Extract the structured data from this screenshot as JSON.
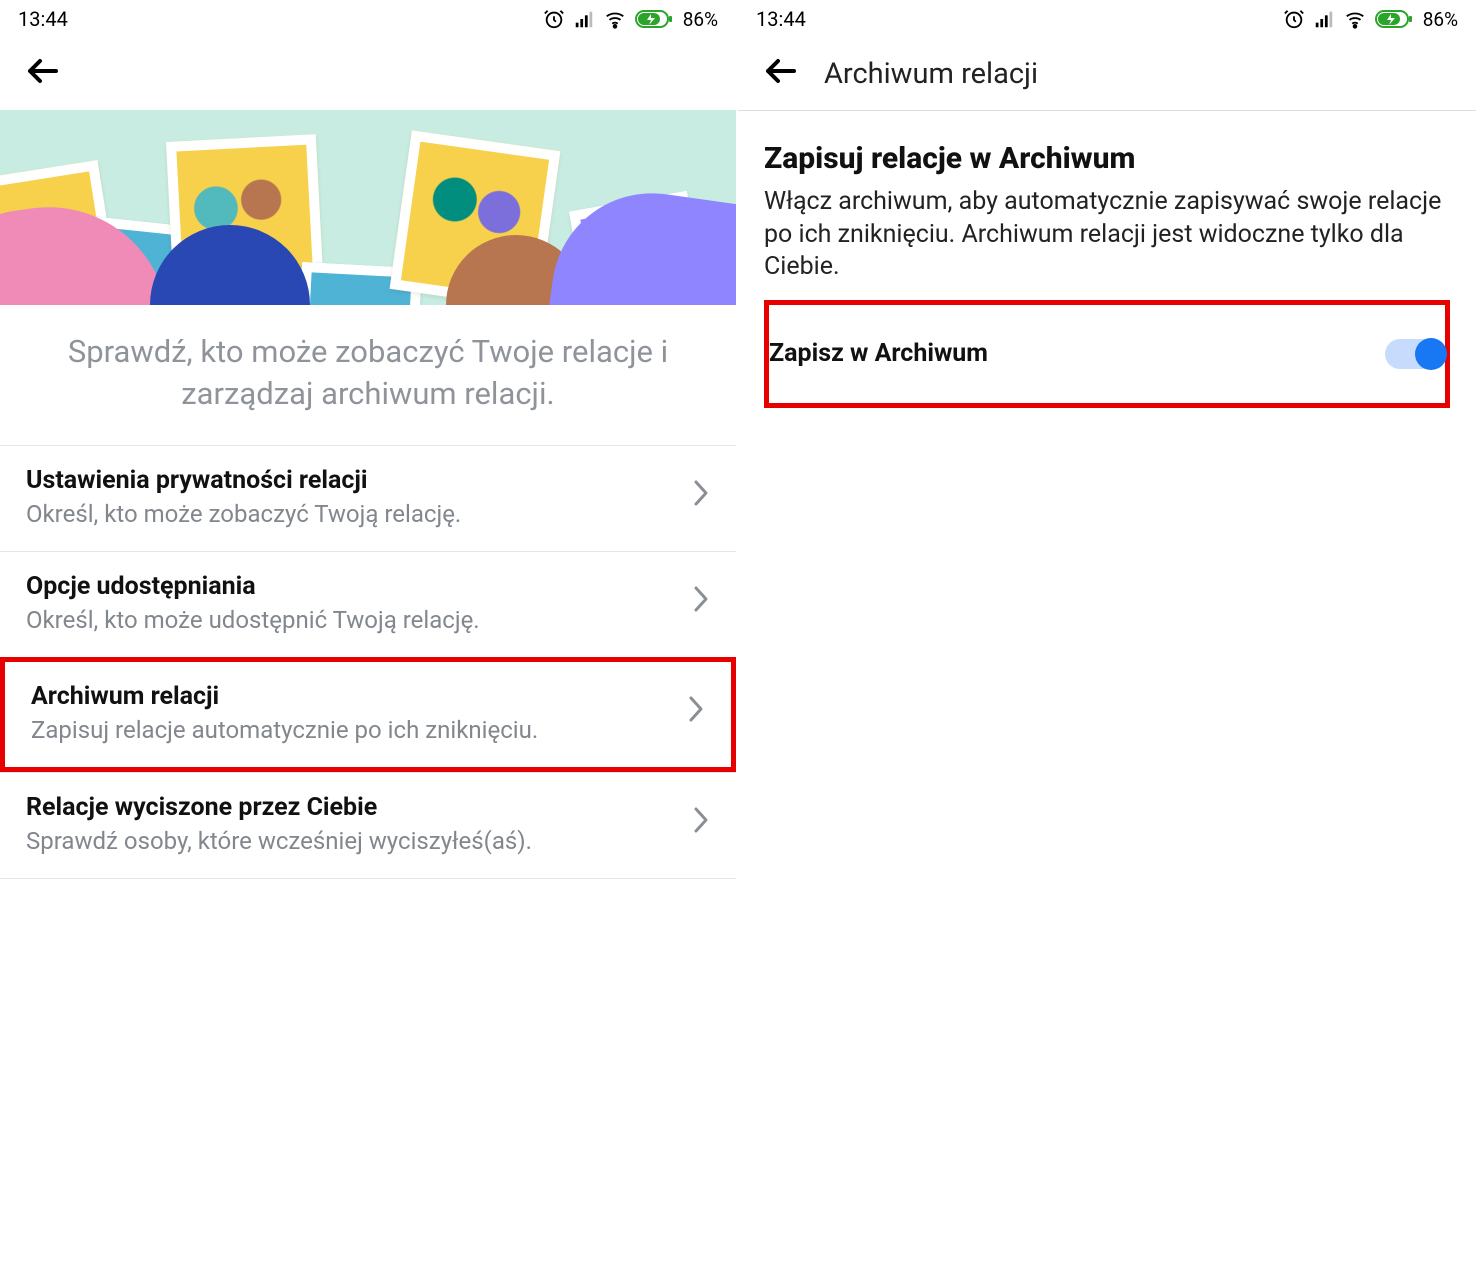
{
  "status": {
    "time": "13:44",
    "battery": "86%"
  },
  "left": {
    "intro": "Sprawdź, kto może zobaczyć Twoje relacje i zarządzaj archiwum relacji.",
    "items": [
      {
        "title": "Ustawienia prywatności relacji",
        "sub": "Określ, kto może zobaczyć Twoją relację."
      },
      {
        "title": "Opcje udostępniania",
        "sub": "Określ, kto może udostępnić Twoją relację."
      },
      {
        "title": "Archiwum relacji",
        "sub": "Zapisuj relacje automatycznie po ich zniknięciu."
      },
      {
        "title": "Relacje wyciszone przez Ciebie",
        "sub": "Sprawdź osoby, które wcześniej wyciszyłeś(aś)."
      }
    ]
  },
  "right": {
    "headerTitle": "Archiwum relacji",
    "heading": "Zapisuj relacje w Archiwum",
    "desc": "Włącz archiwum, aby automatycznie zapisywać swoje relacje po ich zniknięciu. Archiwum relacji jest widoczne tylko dla Ciebie.",
    "toggleLabel": "Zapisz w Archiwum",
    "toggleOn": true
  },
  "highlight": {
    "leftItemIndex": 2,
    "rightToggle": true
  }
}
